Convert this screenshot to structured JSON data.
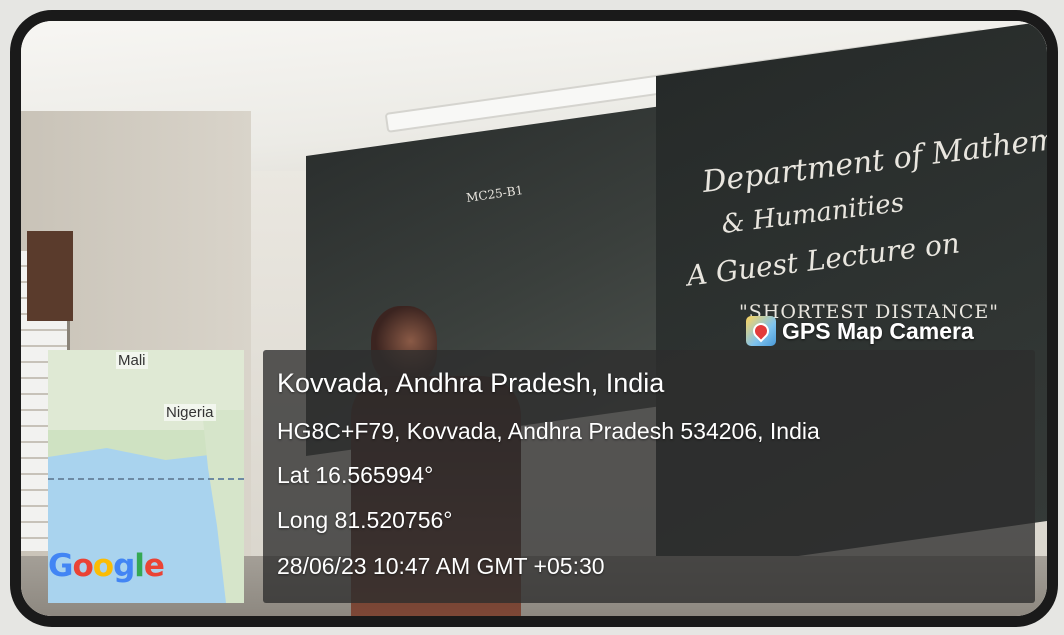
{
  "photo": {
    "board_text": {
      "line1": "Department of Mathematics",
      "line2": "& Humanities",
      "line3": "A Guest Lecture on",
      "line4": "\"SHORTEST DISTANCE\"",
      "room_label": "MC25-B1"
    }
  },
  "stamp": {
    "app_name": "GPS Map Camera",
    "app_icon": "map-pin-icon",
    "location_title": "Kovvada, Andhra Pradesh, India",
    "address": "HG8C+F79, Kovvada, Andhra Pradesh 534206, India",
    "latitude": "Lat 16.565994°",
    "longitude": "Long 81.520756°",
    "datetime": "28/06/23 10:47 AM GMT +05:30"
  },
  "map": {
    "labels": [
      "Mali",
      "Nigeria"
    ],
    "logo_text": "Google",
    "water_color": "#a9d3ee",
    "land_color": "#dfe9d4"
  }
}
